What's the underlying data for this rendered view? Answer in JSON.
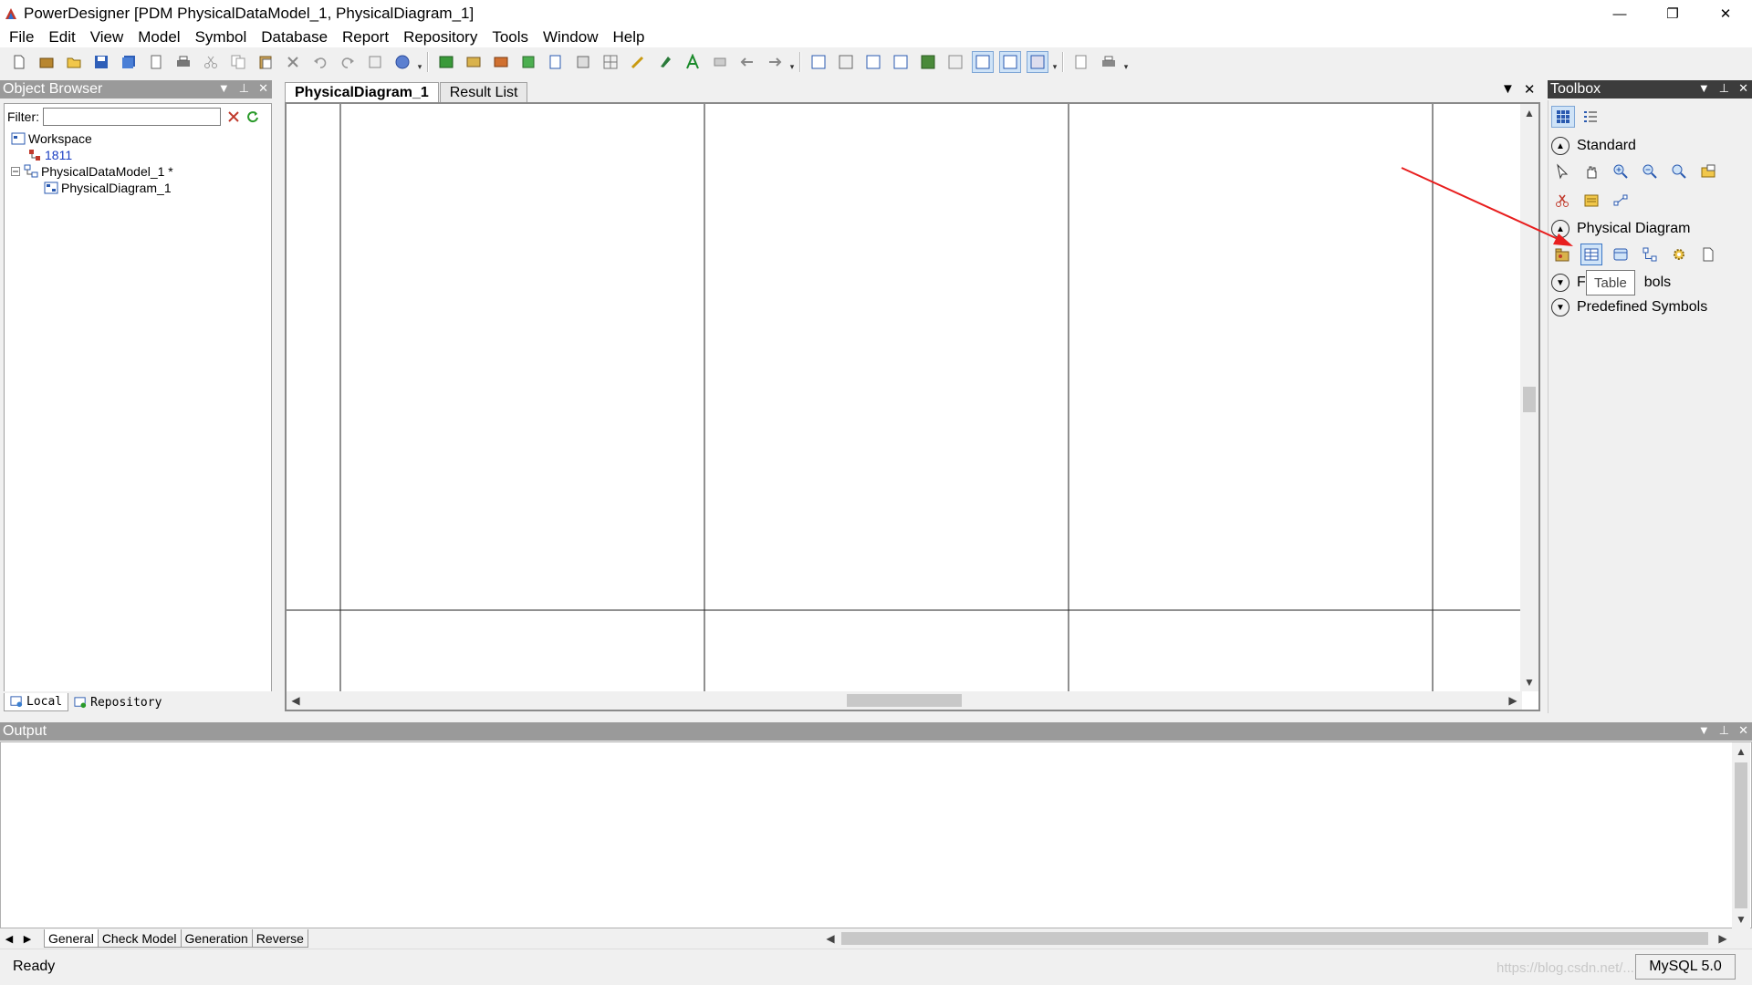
{
  "window": {
    "title": "PowerDesigner [PDM PhysicalDataModel_1, PhysicalDiagram_1]",
    "minimize": "—",
    "restore": "❐",
    "close": "✕"
  },
  "menu": [
    "File",
    "Edit",
    "View",
    "Model",
    "Symbol",
    "Database",
    "Report",
    "Repository",
    "Tools",
    "Window",
    "Help"
  ],
  "object_browser": {
    "title": "Object Browser",
    "filter_label": "Filter:",
    "filter_value": "",
    "tree": [
      {
        "label": "Workspace",
        "icon": "workspace-icon"
      },
      {
        "label": "1811",
        "icon": "model-red-icon"
      },
      {
        "label": "PhysicalDataModel_1 *",
        "icon": "pdm-model-icon"
      },
      {
        "label": "PhysicalDiagram_1",
        "icon": "diagram-icon"
      }
    ],
    "tabs": [
      "Local",
      "Repository"
    ]
  },
  "document": {
    "tabs": [
      "PhysicalDiagram_1",
      "Result List"
    ]
  },
  "toolbox": {
    "title": "Toolbox",
    "sections": {
      "standard": "Standard",
      "physical_diagram": "Physical Diagram",
      "free_symbols": "Free Symbols",
      "predefined_symbols": "Predefined Symbols"
    },
    "tooltip": "Table",
    "free_symbols_visible_left": "F",
    "free_symbols_visible_right": "bols"
  },
  "output": {
    "title": "Output",
    "tabs": [
      "General",
      "Check Model",
      "Generation",
      "Reverse"
    ]
  },
  "status": {
    "text": "Ready",
    "dbms": "MySQL 5.0",
    "watermark": "https://blog.csdn.net/..."
  },
  "colors": {
    "panel_header": "#9a9a9a",
    "link_blue": "#1a3ec2",
    "annotation_arrow": "#e81e1e",
    "selection": "#cfe3f7"
  }
}
